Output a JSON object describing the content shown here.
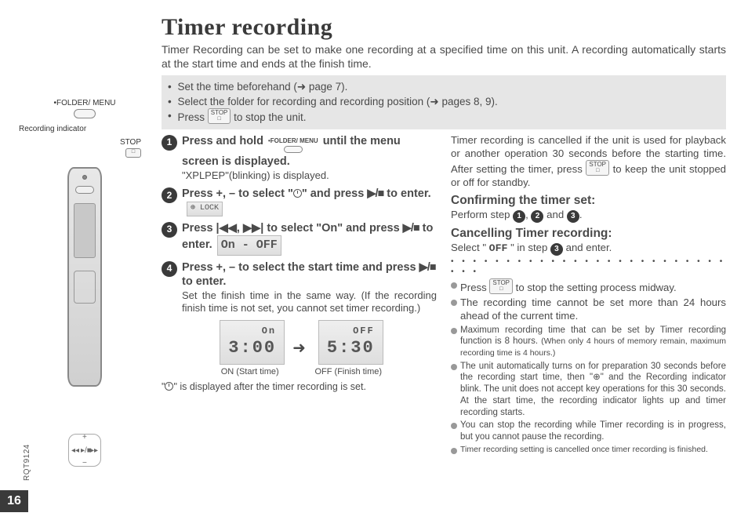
{
  "page_number": "16",
  "doc_code": "RQT9124",
  "title": "Timer recording",
  "intro": "Timer Recording can be set to make one recording at a specified time on this unit. A recording automatically starts at the start time and ends at the finish time.",
  "prep": {
    "line1_a": "Set the time beforehand (",
    "line1_b": " page 7).",
    "line2_a": "Select the folder for recording and recording position (",
    "line2_b": " pages 8, 9).",
    "line3_a": "Press ",
    "line3_b": " to stop the unit."
  },
  "stop_label_top": "STOP",
  "folder_menu_label": "•FOLDER/ MENU",
  "left_labels": {
    "folder_menu": "•FOLDER/ MENU",
    "recording_indicator": "Recording indicator",
    "stop": "STOP"
  },
  "steps": {
    "s1_a": "Press and hold ",
    "s1_b": " until the menu screen is displayed.",
    "s1_note": "\"XPLPEP\"(blinking) is displayed.",
    "s2_a": "Press +, – to select \"",
    "s2_b": "\" and press ",
    "s2_c": " to enter.",
    "s2_lcd": "⊕ LOCK",
    "s3_a": "Press ",
    "s3_b": " to select \"",
    "s3_c": "\" and press ",
    "s3_d": " to enter.",
    "s3_lcd": "On - OFF",
    "s4_a": "Press +, – to select the start time and press ",
    "s4_b": " to enter.",
    "s4_note": "Set the finish time in the same way. (If the recording finish time is not set, you cannot set timer recording.)",
    "lcd_on_top": "On",
    "lcd_on_time": "3:00",
    "lcd_off_top": "OFF",
    "lcd_off_time": "5:30",
    "cap_on": "ON (Start time)",
    "cap_off": "OFF (Finish time)",
    "after": "\" is displayed after the timer recording is set."
  },
  "right": {
    "para1": "Timer recording is cancelled if the unit is used for playback or another operation 30 seconds before the starting time. After setting the timer, press ",
    "para1b": " to keep the unit stopped or off for standby.",
    "h_confirm": "Confirming the timer set:",
    "confirm_a": "Perform step ",
    "confirm_b": ", ",
    "confirm_c": " and ",
    "confirm_d": ".",
    "h_cancel": "Cancelling Timer recording:",
    "cancel_a": "Select \" ",
    "cancel_b": " \" in step ",
    "cancel_c": " and enter.",
    "cancel_lcd": "OFF",
    "b1a": "Press ",
    "b1b": " to stop the setting process midway.",
    "b2": "The recording time cannot be set more than 24 hours ahead of the current time.",
    "b3a": "Maximum recording time that can be set by Timer recording function is 8 hours. ",
    "b3b": "(When only 4 hours of memory remain, maximum recording time is 4 hours.)",
    "b4": "The unit automatically turns on for preparation 30 seconds before the recording start time, then \"⊕\" and the Recording indicator blink. The unit does not accept key operations for this 30 seconds. At the start time, the recording indicator lights up and timer recording starts.",
    "b5": "You can stop the recording while Timer recording is in progress, but you cannot pause the recording.",
    "b6": "Timer recording setting is cancelled once timer recording is finished."
  },
  "glyph": {
    "playstop": "▶/■",
    "rewff": "|◀◀, ▶▶|",
    "rarrow": "➜",
    "onglyph": "On"
  }
}
